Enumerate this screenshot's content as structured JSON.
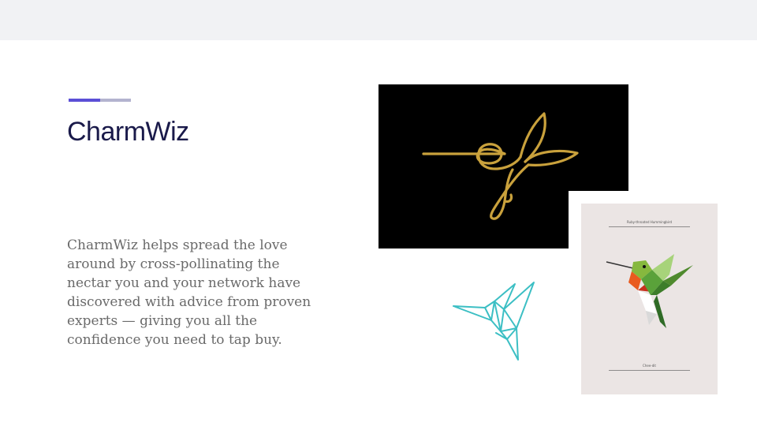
{
  "slide": {
    "title": "CharmWiz",
    "body": "CharmWiz helps spread the love around by cross-pollinating the nectar you and your network have discovered with advice from proven experts — giving you all the confidence you need to tap buy."
  },
  "images": {
    "gold_bird": {
      "icon": "gold-line-hummingbird-icon",
      "stroke_color": "#c9a13c",
      "background": "#000000"
    },
    "crane": {
      "icon": "origami-hummingbird-icon",
      "stroke_color": "#3cbfc4"
    },
    "poster": {
      "icon": "ruby-throated-hummingbird-icon",
      "header": "Ruby-throated Hummingbird",
      "footer": "Chee-dit",
      "background": "#ebe5e4"
    }
  },
  "colors": {
    "accent_primary": "#5b4fd6",
    "accent_secondary": "#b3b3cf",
    "title": "#1a1a4a",
    "body": "#6a6a6a"
  }
}
